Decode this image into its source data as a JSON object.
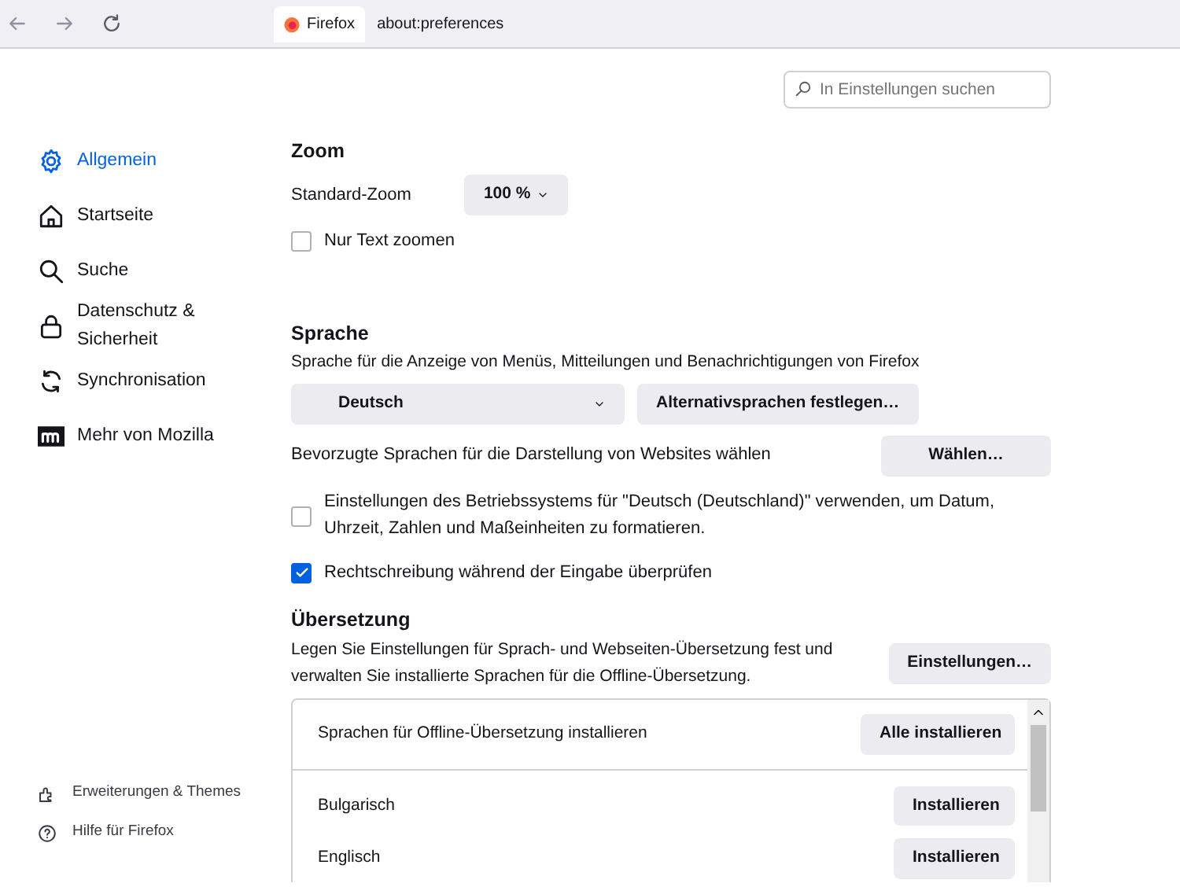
{
  "toolbar": {
    "tab": {
      "label": "Firefox"
    },
    "url": "about:preferences"
  },
  "search": {
    "placeholder": "In Einstellungen suchen"
  },
  "sidebar": {
    "items": [
      {
        "label": "Allgemein",
        "selected": true
      },
      {
        "label": "Startseite",
        "selected": false
      },
      {
        "label": "Suche",
        "selected": false
      },
      {
        "label": "Datenschutz & Sicherheit",
        "selected": false
      },
      {
        "label": "Synchronisation",
        "selected": false
      },
      {
        "label": "Mehr von Mozilla",
        "selected": false
      }
    ],
    "footer": [
      {
        "label": "Erweiterungen & Themes"
      },
      {
        "label": "Hilfe für Firefox"
      }
    ]
  },
  "zoom": {
    "heading": "Zoom",
    "default_label": "Standard-Zoom",
    "default_value": "100 %",
    "text_only": {
      "label": "Nur Text zoomen",
      "checked": false
    }
  },
  "language": {
    "heading": "Sprache",
    "description": "Sprache für die Anzeige von Menüs, Mitteilungen und Benachrichtigungen von Firefox",
    "value": "Deutsch",
    "alternatives_button": "Alternativsprachen festlegen…",
    "websites_label": "Bevorzugte Sprachen für die Darstellung von Websites wählen",
    "websites_button": "Wählen…",
    "options": [
      {
        "label": "Einstellungen des Betriebssystems für \"Deutsch (Deutschland)\" verwenden, um Datum, Uhrzeit, Zahlen und Maßeinheiten zu formatieren.",
        "checked": false
      },
      {
        "label": "Rechtschreibung während der Eingabe überprüfen",
        "checked": true
      }
    ]
  },
  "translation": {
    "heading": "Übersetzung",
    "description": "Legen Sie Einstellungen für Sprach- und Webseiten-Übersetzung fest und verwalten Sie installierte Sprachen für die Offline-Übersetzung.",
    "settings_button": "Einstellungen…",
    "list": {
      "header": {
        "label": "Sprachen für Offline-Übersetzung installieren",
        "button": "Alle installieren"
      },
      "rows": [
        {
          "label": "Bulgarisch",
          "button": "Installieren"
        },
        {
          "label": "Englisch",
          "button": "Installieren"
        }
      ]
    }
  }
}
